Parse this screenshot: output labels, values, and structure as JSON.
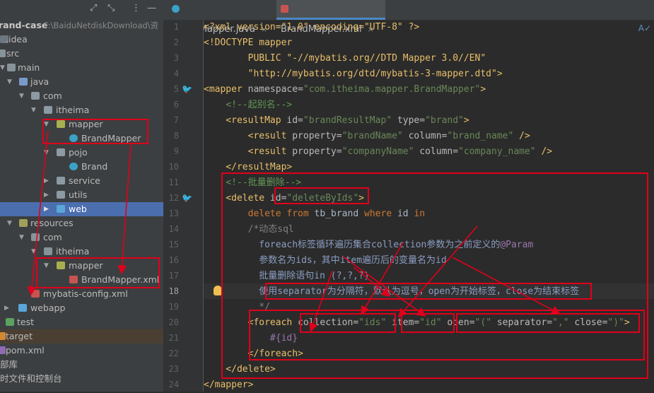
{
  "tree": {
    "toolbar_icons": [
      "expand-icon",
      "collapse-icon",
      "more-icon",
      "hide-icon"
    ],
    "items": [
      {
        "label": "rand-case",
        "hint": "F:\\BaiduNetdiskDownload\\资"
      },
      {
        "label": ".idea"
      },
      {
        "label": "src"
      },
      {
        "label": "main"
      },
      {
        "label": "java"
      },
      {
        "label": "com"
      },
      {
        "label": "itheima"
      },
      {
        "label": "mapper"
      },
      {
        "label": "BrandMapper"
      },
      {
        "label": "pojo"
      },
      {
        "label": "Brand"
      },
      {
        "label": "service"
      },
      {
        "label": "utils"
      },
      {
        "label": "web"
      },
      {
        "label": "resources"
      },
      {
        "label": "com"
      },
      {
        "label": "itheima"
      },
      {
        "label": "mapper"
      },
      {
        "label": "BrandMapper.xml"
      },
      {
        "label": "mybatis-config.xml"
      },
      {
        "label": "webapp"
      },
      {
        "label": "test"
      },
      {
        "label": "target"
      },
      {
        "label": "pom.xml"
      },
      {
        "label": "部库"
      },
      {
        "label": "时文件和控制台"
      }
    ]
  },
  "tabs": [
    {
      "label": "BrandMapper.java",
      "close": "×"
    },
    {
      "label": "BrandMapper.xml",
      "close": "×"
    }
  ],
  "editor": {
    "line_numbers": [
      "1",
      "2",
      "3",
      "4",
      "5",
      "6",
      "7",
      "8",
      "9",
      "10",
      "11",
      "12",
      "13",
      "14",
      "15",
      "16",
      "17",
      "18",
      "19",
      "20",
      "21",
      "22",
      "23",
      "24"
    ],
    "inspection_icon": "inspection-icon",
    "lines": {
      "l1": {
        "a": "<?xml version=\"1.0\" encoding=\"UTF-8\" ?>"
      },
      "l2": {
        "a": "<!DOCTYPE mapper"
      },
      "l3": {
        "a": "        PUBLIC \"-//mybatis.org//DTD Mapper 3.0//EN\""
      },
      "l4": {
        "a": "        \"http://mybatis.org/dtd/mybatis-3-mapper.dtd\">"
      },
      "l5": {
        "tag": "<mapper",
        "attr": " namespace=",
        "val": "\"com.itheima.mapper.BrandMapper\"",
        "end": ">"
      },
      "l6": {
        "a": "    <!--起别名-->"
      },
      "l7": {
        "tag": "    <resultMap",
        "attr1": " id=",
        "val1": "\"brandResultMap\"",
        "attr2": " type=",
        "val2": "\"brand\"",
        "end": ">"
      },
      "l8": {
        "tag": "        <result",
        "attr1": " property=",
        "val1": "\"brandName\"",
        "attr2": " column=",
        "val2": "\"brand_name\"",
        "end": " />"
      },
      "l9": {
        "tag": "        <result",
        "attr1": " property=",
        "val1": "\"companyName\"",
        "attr2": " column=",
        "val2": "\"company_name\"",
        "end": " />"
      },
      "l10": {
        "a": "    </resultMap>"
      },
      "l11": {
        "a": "    <!--批量删除-->"
      },
      "l12": {
        "tag": "    <delete ",
        "attr": "id=",
        "val": "\"deleteByIds\"",
        "end": ">"
      },
      "l13": {
        "kw1": "        delete",
        "kw2": " from",
        "id1": " tb_brand",
        "kw3": " where",
        "id2": " id",
        "kw4": " in"
      },
      "l14": {
        "a": "        /*动态sql"
      },
      "l15": {
        "a": "          foreach标签循环遍历集合collection参数为之前定义的",
        "b": "@Param"
      },
      "l16": {
        "a": "          参数名为ids，其中item遍历后的变量名为id"
      },
      "l17": {
        "a": "          批量删除语句in (?,?,?)"
      },
      "l18": {
        "a": "          使用separator为分隔符，默认为逗号，open为开始标签，close为结束标签"
      },
      "l19": {
        "a": "          */"
      },
      "l20": {
        "tag": "        <foreach ",
        "attr1": "collection=",
        "val1": "\"ids\"",
        "attr2": " item=",
        "val2": "\"id\"",
        "attr3": " open=",
        "val3": "\"(\"",
        "attr4": " separator=",
        "val4": "\",\"",
        "attr5": " close=",
        "val5": "\")\"",
        "end": ">"
      },
      "l21": {
        "a": "            #{id}"
      },
      "l22": {
        "a": "        </foreach>"
      },
      "l23": {
        "a": "    </delete>"
      },
      "l24": {
        "a": "</mapper>"
      }
    }
  },
  "colors": {
    "annotation_red": "#e0001b",
    "tree_bg": "#3c3f41",
    "editor_bg": "#2b2b2b",
    "selection": "#4b6eaf"
  }
}
